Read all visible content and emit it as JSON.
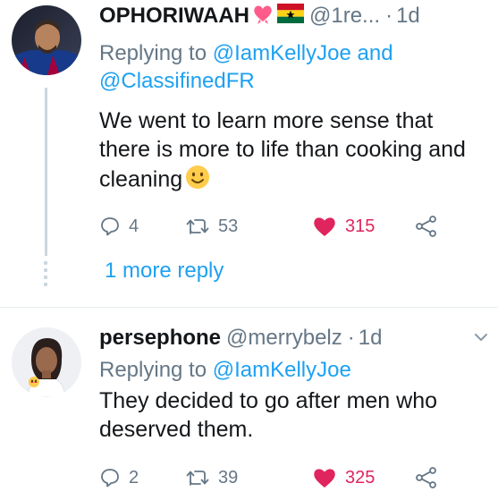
{
  "tweets": [
    {
      "name": "OPHORIWAAH",
      "handle": "@1re...",
      "time": "1d",
      "replying_prefix": "Replying to",
      "replying_to_1": "@IamKellyJoe",
      "replying_and": "and",
      "replying_to_2": "@ClassifinedFR",
      "text": "We went to learn more sense that there is more to life than cooking and cleaning",
      "replies": "4",
      "retweets": "53",
      "likes": "315",
      "name_icons": [
        "heart-ribbon-icon",
        "ghana-flag-icon"
      ],
      "text_emoji": "smiling-face-icon"
    },
    {
      "name": "persephone",
      "handle": "@merrybelz",
      "time": "1d",
      "replying_prefix": "Replying to",
      "replying_to_1": "@IamKellyJoe",
      "text": "They decided to go after men who deserved them.",
      "replies": "2",
      "retweets": "39",
      "likes": "325"
    }
  ],
  "more_reply": "1 more reply",
  "colors": {
    "link": "#1da1f2",
    "muted": "#657786",
    "like": "#e0245e",
    "thread": "#ccd6dd"
  }
}
